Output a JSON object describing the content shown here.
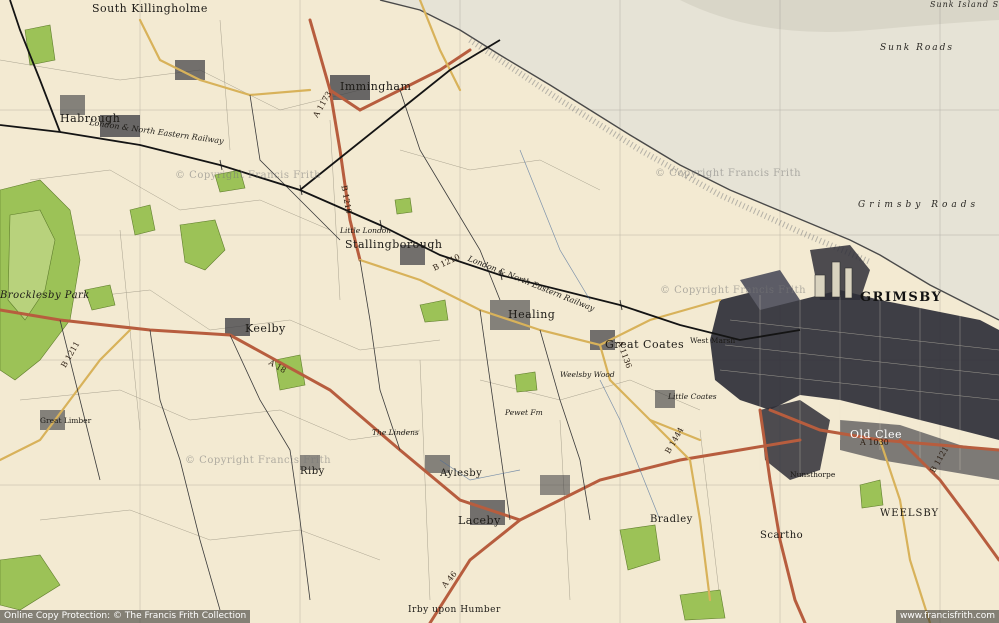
{
  "colors": {
    "paper": "#f3ead2",
    "estuary": "#e4e2d8",
    "woodland": "#9bbf55",
    "urban": "#2c2c34",
    "a_road": "#b65a3c",
    "b_road": "#d8b25a",
    "railway": "#141414",
    "gridline": "#3a3a3a"
  },
  "labels": {
    "south_killingholme": "South Killingholme",
    "immingham": "Immingham",
    "habrough": "Habrough",
    "stallingborough": "Stallingborough",
    "keelby": "Keelby",
    "brocklesby_park": "Brocklesby Park",
    "healing": "Healing",
    "great_coates": "Great Coates",
    "little_coates": "Little Coates",
    "west_marsh": "West Marsh",
    "grimsby": "GRIMSBY",
    "grimsby_roads": "Grimsby Roads",
    "sunk_roads": "Sunk Roads",
    "sunk_island": "Sunk Island S",
    "laceby": "Laceby",
    "aylesby": "Aylesby",
    "riby": "Riby",
    "bradley": "Bradley",
    "scartho": "Scartho",
    "weelsby": "WEELSBY",
    "old_clee": "Old Clee",
    "nunsthorpe": "Nunsthorpe",
    "irby_upon_humber": "Irby upon Humber",
    "the_limbers": "The Lindens",
    "little_london": "Little London",
    "great_limber": "Great Limber",
    "weelsby_wood": "Weelsby Wood",
    "pewet_farm": "Pewet Fm",
    "rail_lner": "London & North Eastern Railway",
    "rail_habrough": "London & North Eastern Railway",
    "road_a18": "A 18",
    "road_a1173": "A 1173",
    "road_b1210": "B 1210",
    "road_a1136": "A 1136",
    "road_b1210b": "B 1210",
    "road_a1030": "A 1030",
    "road_a46": "A 46",
    "road_b1444": "B 1444",
    "road_b1121": "B 1121",
    "road_b1211": "B 1211",
    "watermark_1": "© Copyright Francis Frith",
    "watermark_2": "© Copyright Francis Frith",
    "watermark_3": "© Copyright Francis Frith",
    "watermark_4": "© Copyright Francis Frith"
  },
  "footer": {
    "left": "Online Copy Protection: © The Francis Frith Collection",
    "right": "www.francisfrith.com"
  }
}
